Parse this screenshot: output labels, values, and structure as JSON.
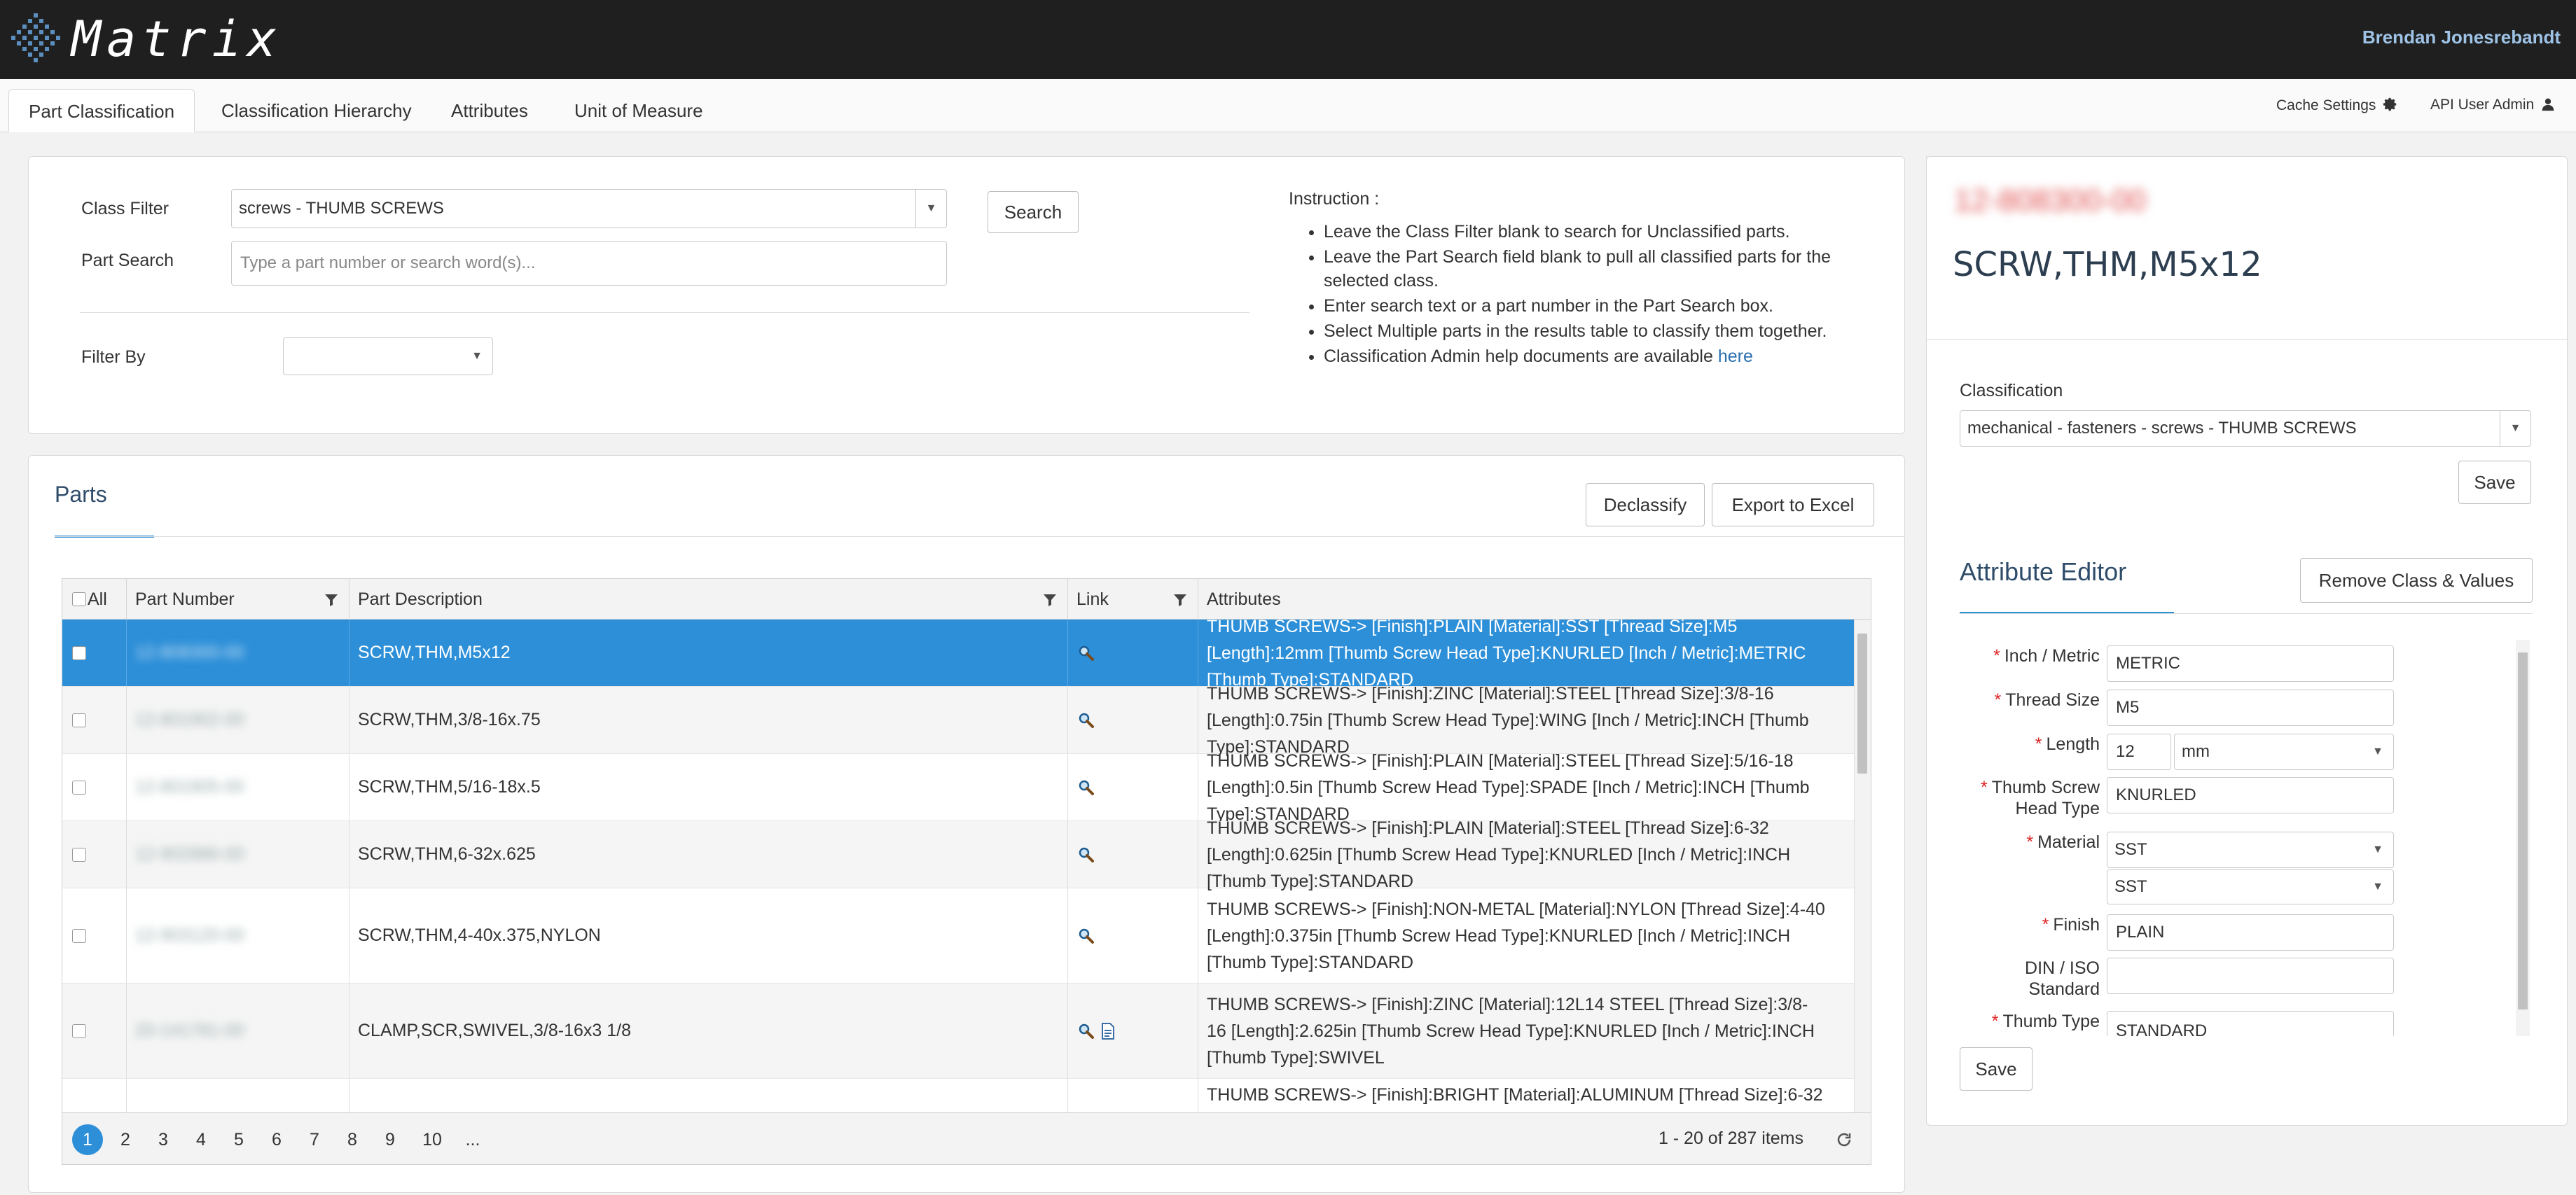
{
  "app": {
    "title": "Matrix",
    "user": "Brendan Jonesrebandt"
  },
  "tabs": [
    {
      "label": "Part Classification",
      "active": true
    },
    {
      "label": "Classification Hierarchy",
      "active": false
    },
    {
      "label": "Attributes",
      "active": false
    },
    {
      "label": "Unit of Measure",
      "active": false
    }
  ],
  "header_right": {
    "cache_settings": "Cache Settings",
    "api_user_admin": "API User Admin"
  },
  "search": {
    "class_filter_label": "Class Filter",
    "class_filter_value": "screws - THUMB SCREWS",
    "part_search_label": "Part Search",
    "part_search_placeholder": "Type a part number or search word(s)...",
    "search_button": "Search",
    "filter_by_label": "Filter By",
    "filter_by_value": ""
  },
  "instruction": {
    "title": "Instruction :",
    "items": [
      "Leave the Class Filter blank to search for Unclassified parts.",
      "Leave the Part Search field blank to pull all classified parts for the selected class.",
      "Enter search text or a part number in the Part Search box.",
      "Select Multiple parts in the results table to classify them together."
    ],
    "help_text": "Classification Admin help documents are available ",
    "help_link": "here"
  },
  "parts": {
    "title": "Parts",
    "declassify_button": "Declassify",
    "export_button": "Export to Excel",
    "columns": {
      "all": "All",
      "part_number": "Part Number",
      "part_description": "Part Description",
      "link": "Link",
      "attributes": "Attributes"
    },
    "rows": [
      {
        "part_number": "12-808300-00",
        "description": "SCRW,THM,M5x12",
        "attributes": "THUMB SCREWS-> [Finish]:PLAIN [Material]:SST [Thread Size]:M5 [Length]:12mm [Thumb Screw Head Type]:KNURLED [Inch / Metric]:METRIC [Thumb Type]:STANDARD",
        "links": 1,
        "selected": true
      },
      {
        "part_number": "12-801902-00",
        "description": "SCRW,THM,3/8-16x.75",
        "attributes": "THUMB SCREWS-> [Finish]:ZINC [Material]:STEEL [Thread Size]:3/8-16 [Length]:0.75in [Thumb Screw Head Type]:WING [Inch / Metric]:INCH [Thumb Type]:STANDARD",
        "links": 1,
        "selected": false
      },
      {
        "part_number": "12-801905-00",
        "description": "SCRW,THM,5/16-18x.5",
        "attributes": "THUMB SCREWS-> [Finish]:PLAIN [Material]:STEEL [Thread Size]:5/16-18 [Length]:0.5in [Thumb Screw Head Type]:SPADE [Inch / Metric]:INCH [Thumb Type]:STANDARD",
        "links": 1,
        "selected": false
      },
      {
        "part_number": "12-902886-00",
        "description": "SCRW,THM,6-32x.625",
        "attributes": "THUMB SCREWS-> [Finish]:PLAIN [Material]:STEEL [Thread Size]:6-32 [Length]:0.625in [Thumb Screw Head Type]:KNURLED [Inch / Metric]:INCH [Thumb Type]:STANDARD",
        "links": 1,
        "selected": false
      },
      {
        "part_number": "12-903120-00",
        "description": "SCRW,THM,4-40x.375,NYLON",
        "attributes": "THUMB SCREWS-> [Finish]:NON-METAL [Material]:NYLON [Thread Size]:4-40 [Length]:0.375in [Thumb Screw Head Type]:KNURLED [Inch / Metric]:INCH [Thumb Type]:STANDARD",
        "links": 1,
        "selected": false
      },
      {
        "part_number": "20-141781-00",
        "description": "CLAMP,SCR,SWIVEL,3/8-16x3 1/8",
        "attributes": "THUMB SCREWS-> [Finish]:ZINC [Material]:12L14 STEEL [Thread Size]:3/8-16 [Length]:2.625in [Thumb Screw Head Type]:KNURLED [Inch / Metric]:INCH [Thumb Type]:SWIVEL",
        "links": 2,
        "selected": false
      },
      {
        "part_number": "",
        "description": "",
        "attributes": "THUMB SCREWS-> [Finish]:BRIGHT [Material]:ALUMINUM [Thread Size]:6-32",
        "links": 0,
        "selected": false
      }
    ],
    "pages": [
      "1",
      "2",
      "3",
      "4",
      "5",
      "6",
      "7",
      "8",
      "9",
      "10",
      "..."
    ],
    "pager_info": "1 - 20 of 287 items"
  },
  "detail": {
    "part_number": "12-808300-00",
    "description": "SCRW,THM,M5x12",
    "classification_label": "Classification",
    "classification_value": "mechanical - fasteners - screws - THUMB SCREWS",
    "save_button": "Save",
    "attribute_editor_title": "Attribute Editor",
    "remove_button": "Remove Class & Values",
    "attributes": {
      "inch_metric_label": "Inch / Metric",
      "inch_metric_value": "METRIC",
      "thread_size_label": "Thread Size",
      "thread_size_value": "M5",
      "length_label": "Length",
      "length_value": "12",
      "length_unit": "mm",
      "head_type_label_1": "Thumb Screw",
      "head_type_label_2": "Head Type",
      "head_type_value": "KNURLED",
      "material_label": "Material",
      "material_value_1": "SST",
      "material_value_2": "SST",
      "finish_label": "Finish",
      "finish_value": "PLAIN",
      "din_label_1": "DIN / ISO",
      "din_label_2": "Standard",
      "din_value": "",
      "thumb_type_label": "Thumb Type",
      "thumb_type_value": "STANDARD"
    },
    "save_button_2": "Save"
  },
  "colors": {
    "accent": "#2c8fd8",
    "header_bg": "#1f1f1f",
    "required": "#dd2222"
  }
}
